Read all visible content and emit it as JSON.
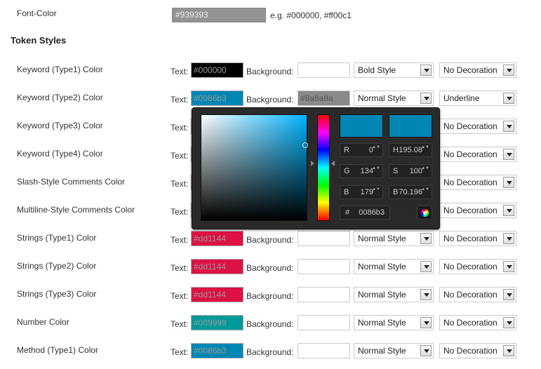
{
  "font_color": {
    "label": "Font-Color",
    "value": "#939393",
    "hint": "e.g. #000000, #ff00c1"
  },
  "section_title": "Token Styles",
  "labels": {
    "text": "Text:",
    "background": "Background:"
  },
  "rows": [
    {
      "label": "Keyword (Type1) Color",
      "text_value": "#000000",
      "text_color": "#000000",
      "bg_value": "",
      "bg_color": "#ffffff",
      "style": "Bold Style",
      "decoration": "No Decoration"
    },
    {
      "label": "Keyword (Type2) Color",
      "text_value": "#0086b3",
      "text_color": "#0086b3",
      "bg_value": "#8a8a8a",
      "bg_color": "#8a8a8a",
      "style": "Normal Style",
      "decoration": "Underline"
    },
    {
      "label": "Keyword (Type3) Color",
      "text_value": "",
      "text_color": "#1a1a5a",
      "bg_value": "",
      "bg_color": "#ffffff",
      "style": "",
      "decoration": "No Decoration"
    },
    {
      "label": "Keyword (Type4) Color",
      "text_value": "",
      "text_color": "#7a0a5a",
      "bg_value": "",
      "bg_color": "#ffffff",
      "style": "",
      "decoration": "No Decoration"
    },
    {
      "label": "Slash-Style Comments Color",
      "text_value": "",
      "text_color": "#2a2a2a",
      "bg_value": "",
      "bg_color": "#ffffff",
      "style": "",
      "decoration": "No Decoration"
    },
    {
      "label": "Multiline-Style Comments Color",
      "text_value": "",
      "text_color": "#2a2a2a",
      "bg_value": "",
      "bg_color": "#ffffff",
      "style": "",
      "decoration": "No Decoration"
    },
    {
      "label": "Strings (Type1) Color",
      "text_value": "#dd1144",
      "text_color": "#dd1144",
      "bg_value": "",
      "bg_color": "#ffffff",
      "style": "Normal Style",
      "decoration": "No Decoration"
    },
    {
      "label": "Strings (Type2) Color",
      "text_value": "#dd1144",
      "text_color": "#dd1144",
      "bg_value": "",
      "bg_color": "#ffffff",
      "style": "Normal Style",
      "decoration": "No Decoration"
    },
    {
      "label": "Strings (Type3) Color",
      "text_value": "#dd1144",
      "text_color": "#dd1144",
      "bg_value": "",
      "bg_color": "#ffffff",
      "style": "Normal Style",
      "decoration": "No Decoration"
    },
    {
      "label": "Number Color",
      "text_value": "#009999",
      "text_color": "#009999",
      "bg_value": "",
      "bg_color": "#ffffff",
      "style": "Normal Style",
      "decoration": "No Decoration"
    },
    {
      "label": "Method (Type1) Color",
      "text_value": "#0086b3",
      "text_color": "#0086b3",
      "bg_value": "",
      "bg_color": "#ffffff",
      "style": "Normal Style",
      "decoration": "No Decoration"
    }
  ],
  "color_picker": {
    "new_color": "#0086b3",
    "current_color": "#0086b3",
    "r": {
      "label": "R",
      "value": "0"
    },
    "g": {
      "label": "G",
      "value": "134"
    },
    "b": {
      "label": "B",
      "value": "179"
    },
    "h": {
      "label": "H",
      "value": "195.08"
    },
    "s": {
      "label": "S",
      "value": "100"
    },
    "bri": {
      "label": "B",
      "value": "70.196"
    },
    "hex": {
      "label": "#",
      "value": "0086b3"
    },
    "spinner_glyph": "▲▼"
  }
}
